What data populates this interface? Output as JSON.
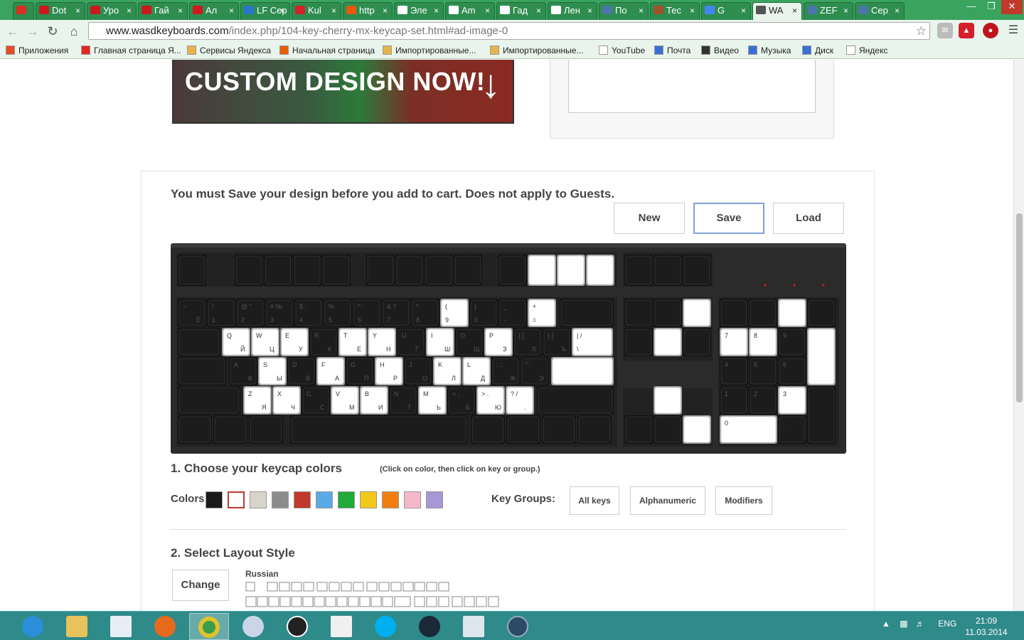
{
  "browser": {
    "tabs": [
      {
        "label": "Dot",
        "color": "#cc181e"
      },
      {
        "label": "Уро",
        "color": "#cc181e"
      },
      {
        "label": "Гай",
        "color": "#cc181e"
      },
      {
        "label": "Ал",
        "color": "#cc181e"
      },
      {
        "label": "LF Сер",
        "color": "#2a74c9"
      },
      {
        "label": "Kul",
        "color": "#d2232a"
      },
      {
        "label": "http",
        "color": "#e8590c"
      },
      {
        "label": "Эле",
        "color": "#ffffff"
      },
      {
        "label": "Am",
        "color": "#ffffff"
      },
      {
        "label": "Гад",
        "color": "#ffffff"
      },
      {
        "label": "Лен",
        "color": "#ffffff"
      },
      {
        "label": "По",
        "color": "#4a76a8"
      },
      {
        "label": "Тес",
        "color": "#a0522d"
      },
      {
        "label": "G",
        "color": "#4285f4"
      },
      {
        "label": "WA",
        "color": "#555555"
      },
      {
        "label": "ZEF",
        "color": "#4a76a8"
      },
      {
        "label": "Сер",
        "color": "#4a76a8"
      }
    ],
    "url_host": "www.wasdkeyboards.com",
    "url_path": "/index.php/104-key-cherry-mx-keycap-set.html#ad-image-0",
    "bookmarks": [
      {
        "label": "Приложения",
        "color": "#e44d26"
      },
      {
        "label": "Главная страница Я...",
        "color": "#e52620"
      },
      {
        "label": "Сервисы Яндекса",
        "color": "#e9b447"
      },
      {
        "label": "Начальная страница",
        "color": "#e66000"
      },
      {
        "label": "Импортированные...",
        "color": "#e9b447"
      },
      {
        "label": "Импортированные...",
        "color": "#e9b447"
      },
      {
        "label": "YouTube",
        "color": "#ffffff"
      },
      {
        "label": "Почта",
        "color": "#3b6fd6"
      },
      {
        "label": "Видео",
        "color": "#333333"
      },
      {
        "label": "Музыка",
        "color": "#3b6fd6"
      },
      {
        "label": "Диск",
        "color": "#3b6fd6"
      },
      {
        "label": "Яндекс",
        "color": "#ffffff"
      }
    ]
  },
  "banner": {
    "headline_main": "CUSTOM DESIGN ",
    "headline_bold": "NOW!"
  },
  "designer": {
    "notice": "You must Save your design before you add to cart. Does not apply to Guests.",
    "buttons": {
      "new": "New",
      "save": "Save",
      "load": "Load"
    },
    "step1_title": "1. Choose your keycap colors",
    "step1_hint": "(Click on color, then click on key or group.)",
    "colors_label": "Colors:",
    "colors": [
      "#1a1a1a",
      "#ffffff",
      "#d8d4cc",
      "#8c8c8c",
      "#c0392b",
      "#5aaae6",
      "#1faa3a",
      "#f2c81a",
      "#f07f10",
      "#f5b8c8",
      "#a897d6"
    ],
    "selected_color_index": 1,
    "key_groups_label": "Key Groups:",
    "key_groups": [
      "All keys",
      "Alphanumeric",
      "Modifiers"
    ],
    "step2_title": "2. Select Layout Style",
    "change_label": "Change",
    "layout_name": "Russian"
  },
  "keyboard": {
    "case_color": "#2b2b2b",
    "key_black": "#1c1c1c",
    "key_white": "#ffffff",
    "legend_dark": "#555555",
    "legend_light": "#333333",
    "led_color": "#cc2222"
  },
  "taskbar": {
    "lang": "ENG",
    "time": "21:09",
    "date": "11.03.2014"
  }
}
